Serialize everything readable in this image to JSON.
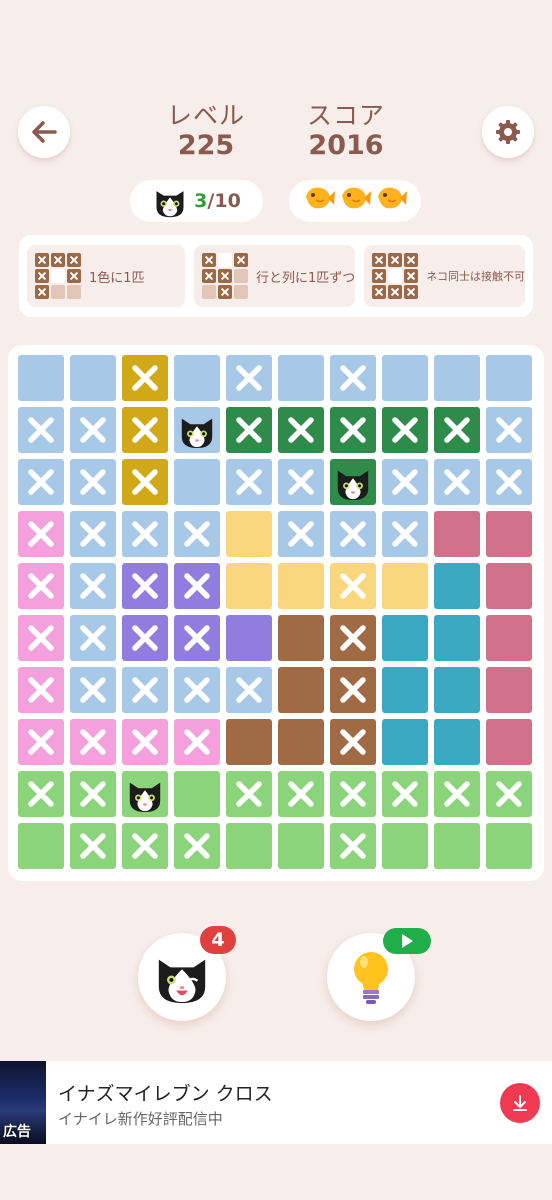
{
  "header": {
    "level_label": "レベル",
    "level_value": "225",
    "score_label": "スコア",
    "score_value": "2016"
  },
  "progress": {
    "current": "3",
    "separator": "/",
    "total": "10"
  },
  "bonus_fish_count": 3,
  "rules": [
    {
      "text": "1色に1匹",
      "pattern": [
        "x",
        "x",
        "x",
        "x",
        "c",
        "x",
        "x",
        "e",
        "e"
      ]
    },
    {
      "text": "行と列に1匹ずつ",
      "pattern": [
        "x",
        "c",
        "x",
        "x",
        "x",
        "e",
        "e",
        "x",
        "e"
      ]
    },
    {
      "text": "ネコ同士は接触不可",
      "pattern": [
        "x",
        "x",
        "x",
        "x",
        "c",
        "x",
        "x",
        "x",
        "x"
      ]
    }
  ],
  "board": {
    "size": 10,
    "colors": {
      "B": "#a8c8e8",
      "Y": "#d0a818",
      "G": "#2e8b4a",
      "P": "#f4a0dc",
      "S": "#fad67e",
      "R": "#d0708a",
      "V": "#8f7ee0",
      "T": "#3aa8c0",
      "N": "#a06a45",
      "L": "#8cd47c"
    },
    "regions": [
      "BBYBBBBBBB",
      "BBYBGGGGGB",
      "BBYBBBGBBB",
      "PBBBSBBBRR",
      "PBVVSSSSTR",
      "PBVVVNNTTR",
      "PBBBBNNTTR",
      "PPPPNNNTTR",
      "LLLLLLLLLL",
      "LLLLLLLLLL"
    ],
    "marks": [
      "..X.X.X...",
      "XXXCXXXXXX",
      "XXX.XXCXXX",
      "XXXX.XXX..",
      "XXXX..X...",
      "XXXX..X...",
      "XXXXX.X...",
      "XXXX..X...",
      "XXC.XXXXXX",
      ".XXX..X..."
    ]
  },
  "hints": {
    "cat_hint_count": "4"
  },
  "ad": {
    "tag": "広告",
    "title": "イナズマイレブン クロス",
    "subtitle": "イナイレ新作好評配信中",
    "accent": "#f03a52"
  }
}
